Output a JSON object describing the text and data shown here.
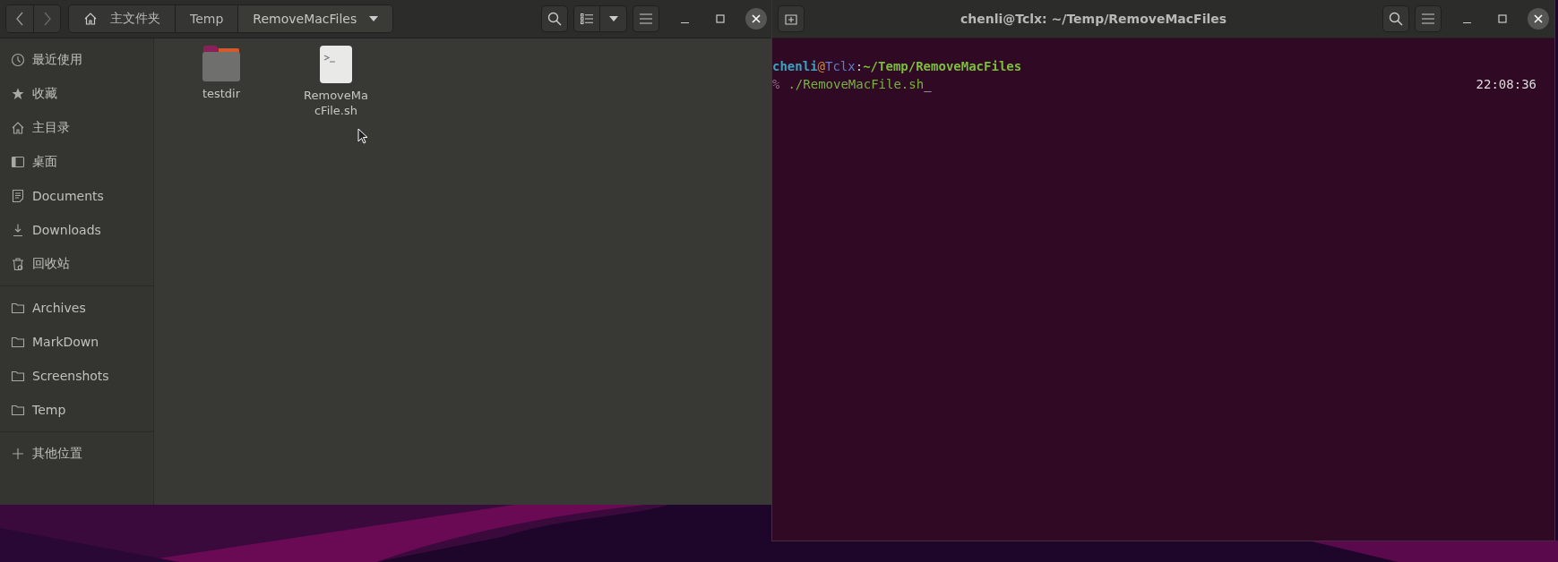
{
  "file_manager": {
    "path": [
      {
        "label": "主文件夹",
        "kind": "home",
        "selected": false
      },
      {
        "label": "Temp",
        "kind": "folder",
        "selected": false
      },
      {
        "label": "RemoveMacFiles",
        "kind": "folder",
        "selected": true
      }
    ],
    "sidebar": {
      "sections": [
        {
          "items": [
            {
              "label": "最近使用",
              "kind": "recent"
            },
            {
              "label": "收藏",
              "kind": "starred"
            },
            {
              "label": "主目录",
              "kind": "home"
            },
            {
              "label": "桌面",
              "kind": "desktop"
            },
            {
              "label": "Documents",
              "kind": "documents"
            },
            {
              "label": "Downloads",
              "kind": "downloads"
            },
            {
              "label": "回收站",
              "kind": "trash"
            }
          ]
        },
        {
          "items": [
            {
              "label": "Archives",
              "kind": "folder"
            },
            {
              "label": "MarkDown",
              "kind": "folder"
            },
            {
              "label": "Screenshots",
              "kind": "folder"
            },
            {
              "label": "Temp",
              "kind": "folder"
            }
          ]
        },
        {
          "items": [
            {
              "label": "其他位置",
              "kind": "other"
            }
          ]
        }
      ]
    },
    "files": [
      {
        "name": "testdir",
        "kind": "folder"
      },
      {
        "name": "RemoveMacFile.sh",
        "kind": "script"
      }
    ]
  },
  "terminal": {
    "title": "chenli@Tclx: ~/Temp/RemoveMacFiles",
    "prompt": {
      "user": "chenli",
      "at": "@",
      "host": "Tclx",
      "separator": ":",
      "path": "~/Temp/RemoveMacFiles"
    },
    "command_line": {
      "symbol": "%",
      "command": "./RemoveMacFile.sh",
      "cursor": "_",
      "time": "22:08:36"
    }
  }
}
